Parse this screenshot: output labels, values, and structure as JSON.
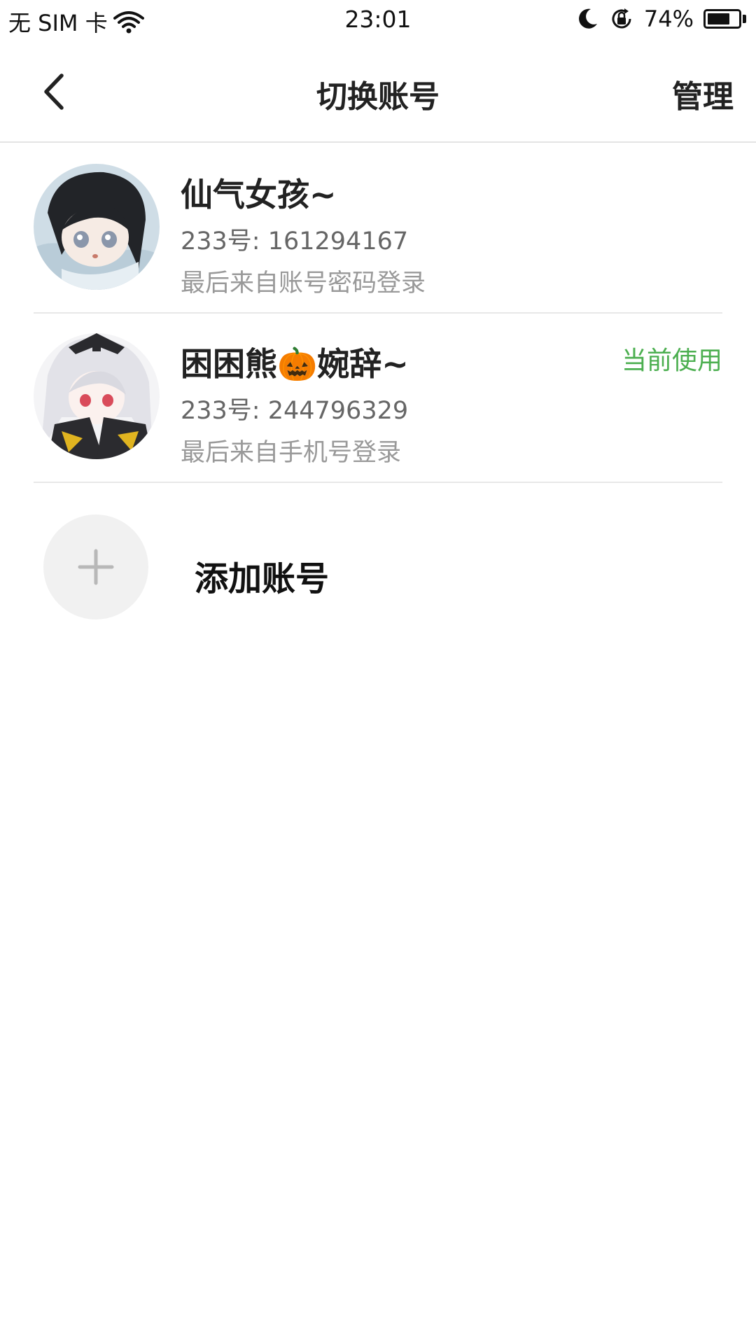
{
  "status_bar": {
    "carrier": "无 SIM 卡",
    "time": "23:01",
    "battery_percent": "74%",
    "battery_level": 0.74,
    "icons": [
      "wifi-icon",
      "moon-icon",
      "rotation-lock-icon",
      "battery-icon"
    ]
  },
  "nav": {
    "title": "切换账号",
    "manage_label": "管理",
    "back_icon": "chevron-left-icon"
  },
  "accounts": [
    {
      "name": "仙气女孩~",
      "id_text": "233号: 161294167",
      "login_text": "最后来自账号密码登录",
      "current_label": ""
    },
    {
      "name": "困困熊🎃婉辞~",
      "id_text": "233号: 244796329",
      "login_text": "最后来自手机号登录",
      "current_label": "当前使用"
    }
  ],
  "add_account": {
    "label": "添加账号",
    "icon": "plus-icon"
  },
  "colors": {
    "accent_green": "#4caf50",
    "divider": "#e8e8e8",
    "add_circle_bg": "#f1f1f1"
  }
}
